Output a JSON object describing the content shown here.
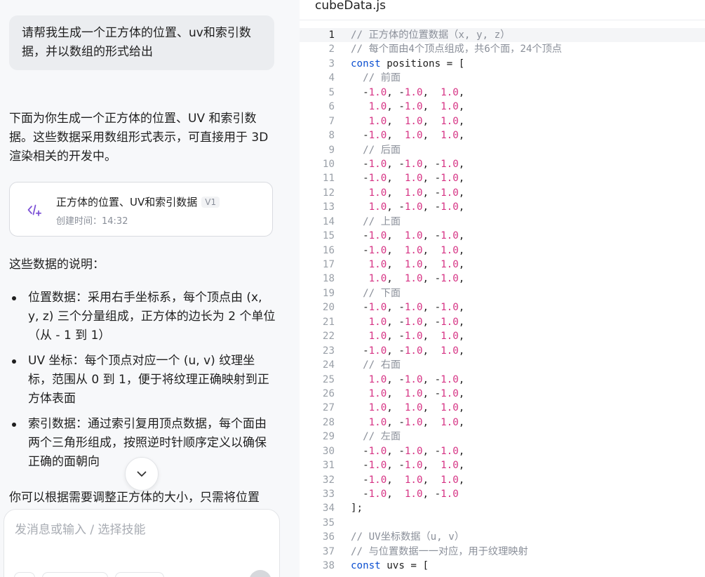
{
  "chat": {
    "user_message": "请帮我生成一个正方体的位置、uv和索引数据，并以数组的形式给出",
    "assistant_intro": "下面为你生成一个正方体的位置、UV 和索引数据。这些数据采用数组形式表示，可直接用于 3D 渲染相关的开发中。",
    "artifact": {
      "title": "正方体的位置、UV和索引数据",
      "version": "V1",
      "created": "创建时间：14:32"
    },
    "explain_heading": "这些数据的说明：",
    "bullets": [
      "位置数据：采用右手坐标系，每个顶点由 (x, y, z) 三个分量组成，正方体的边长为 2 个单位（从 - 1 到 1）",
      "UV 坐标：每个顶点对应一个 (u, v) 纹理坐标，范围从 0 到 1，便于将纹理正确映射到正方体表面",
      "索引数据：通过索引复用顶点数据，每个面由两个三角形组成，按照逆时针顺序定义以确保正确的面朝向"
    ],
    "tail_text": "你可以根据需要调整正方体的大小，只需将位置",
    "composer_placeholder": "发消息或输入 / 选择技能"
  },
  "editor": {
    "file_name": "cubeData.js",
    "active_line": 1,
    "lines": [
      [
        [
          "c",
          "// 正方体的位置数据（x, y, z）"
        ]
      ],
      [
        [
          "c",
          "// 每个面由4个顶点组成，共6个面，24个顶点"
        ]
      ],
      [
        [
          "k",
          "const"
        ],
        [
          "p",
          " positions = ["
        ]
      ],
      [
        [
          "c",
          "  // 前面"
        ]
      ],
      [
        [
          "p",
          "  -"
        ],
        [
          "n",
          "1.0"
        ],
        [
          "p",
          ", -"
        ],
        [
          "n",
          "1.0"
        ],
        [
          "p",
          ",  "
        ],
        [
          "n",
          "1.0"
        ],
        [
          "p",
          ","
        ]
      ],
      [
        [
          "p",
          "   "
        ],
        [
          "n",
          "1.0"
        ],
        [
          "p",
          ", -"
        ],
        [
          "n",
          "1.0"
        ],
        [
          "p",
          ",  "
        ],
        [
          "n",
          "1.0"
        ],
        [
          "p",
          ","
        ]
      ],
      [
        [
          "p",
          "   "
        ],
        [
          "n",
          "1.0"
        ],
        [
          "p",
          ",  "
        ],
        [
          "n",
          "1.0"
        ],
        [
          "p",
          ",  "
        ],
        [
          "n",
          "1.0"
        ],
        [
          "p",
          ","
        ]
      ],
      [
        [
          "p",
          "  -"
        ],
        [
          "n",
          "1.0"
        ],
        [
          "p",
          ",  "
        ],
        [
          "n",
          "1.0"
        ],
        [
          "p",
          ",  "
        ],
        [
          "n",
          "1.0"
        ],
        [
          "p",
          ","
        ]
      ],
      [
        [
          "c",
          "  // 后面"
        ]
      ],
      [
        [
          "p",
          "  -"
        ],
        [
          "n",
          "1.0"
        ],
        [
          "p",
          ", -"
        ],
        [
          "n",
          "1.0"
        ],
        [
          "p",
          ", -"
        ],
        [
          "n",
          "1.0"
        ],
        [
          "p",
          ","
        ]
      ],
      [
        [
          "p",
          "  -"
        ],
        [
          "n",
          "1.0"
        ],
        [
          "p",
          ",  "
        ],
        [
          "n",
          "1.0"
        ],
        [
          "p",
          ", -"
        ],
        [
          "n",
          "1.0"
        ],
        [
          "p",
          ","
        ]
      ],
      [
        [
          "p",
          "   "
        ],
        [
          "n",
          "1.0"
        ],
        [
          "p",
          ",  "
        ],
        [
          "n",
          "1.0"
        ],
        [
          "p",
          ", -"
        ],
        [
          "n",
          "1.0"
        ],
        [
          "p",
          ","
        ]
      ],
      [
        [
          "p",
          "   "
        ],
        [
          "n",
          "1.0"
        ],
        [
          "p",
          ", -"
        ],
        [
          "n",
          "1.0"
        ],
        [
          "p",
          ", -"
        ],
        [
          "n",
          "1.0"
        ],
        [
          "p",
          ","
        ]
      ],
      [
        [
          "c",
          "  // 上面"
        ]
      ],
      [
        [
          "p",
          "  -"
        ],
        [
          "n",
          "1.0"
        ],
        [
          "p",
          ",  "
        ],
        [
          "n",
          "1.0"
        ],
        [
          "p",
          ", -"
        ],
        [
          "n",
          "1.0"
        ],
        [
          "p",
          ","
        ]
      ],
      [
        [
          "p",
          "  -"
        ],
        [
          "n",
          "1.0"
        ],
        [
          "p",
          ",  "
        ],
        [
          "n",
          "1.0"
        ],
        [
          "p",
          ",  "
        ],
        [
          "n",
          "1.0"
        ],
        [
          "p",
          ","
        ]
      ],
      [
        [
          "p",
          "   "
        ],
        [
          "n",
          "1.0"
        ],
        [
          "p",
          ",  "
        ],
        [
          "n",
          "1.0"
        ],
        [
          "p",
          ",  "
        ],
        [
          "n",
          "1.0"
        ],
        [
          "p",
          ","
        ]
      ],
      [
        [
          "p",
          "   "
        ],
        [
          "n",
          "1.0"
        ],
        [
          "p",
          ",  "
        ],
        [
          "n",
          "1.0"
        ],
        [
          "p",
          ", -"
        ],
        [
          "n",
          "1.0"
        ],
        [
          "p",
          ","
        ]
      ],
      [
        [
          "c",
          "  // 下面"
        ]
      ],
      [
        [
          "p",
          "  -"
        ],
        [
          "n",
          "1.0"
        ],
        [
          "p",
          ", -"
        ],
        [
          "n",
          "1.0"
        ],
        [
          "p",
          ", -"
        ],
        [
          "n",
          "1.0"
        ],
        [
          "p",
          ","
        ]
      ],
      [
        [
          "p",
          "   "
        ],
        [
          "n",
          "1.0"
        ],
        [
          "p",
          ", -"
        ],
        [
          "n",
          "1.0"
        ],
        [
          "p",
          ", -"
        ],
        [
          "n",
          "1.0"
        ],
        [
          "p",
          ","
        ]
      ],
      [
        [
          "p",
          "   "
        ],
        [
          "n",
          "1.0"
        ],
        [
          "p",
          ", -"
        ],
        [
          "n",
          "1.0"
        ],
        [
          "p",
          ",  "
        ],
        [
          "n",
          "1.0"
        ],
        [
          "p",
          ","
        ]
      ],
      [
        [
          "p",
          "  -"
        ],
        [
          "n",
          "1.0"
        ],
        [
          "p",
          ", -"
        ],
        [
          "n",
          "1.0"
        ],
        [
          "p",
          ",  "
        ],
        [
          "n",
          "1.0"
        ],
        [
          "p",
          ","
        ]
      ],
      [
        [
          "c",
          "  // 右面"
        ]
      ],
      [
        [
          "p",
          "   "
        ],
        [
          "n",
          "1.0"
        ],
        [
          "p",
          ", -"
        ],
        [
          "n",
          "1.0"
        ],
        [
          "p",
          ", -"
        ],
        [
          "n",
          "1.0"
        ],
        [
          "p",
          ","
        ]
      ],
      [
        [
          "p",
          "   "
        ],
        [
          "n",
          "1.0"
        ],
        [
          "p",
          ",  "
        ],
        [
          "n",
          "1.0"
        ],
        [
          "p",
          ", -"
        ],
        [
          "n",
          "1.0"
        ],
        [
          "p",
          ","
        ]
      ],
      [
        [
          "p",
          "   "
        ],
        [
          "n",
          "1.0"
        ],
        [
          "p",
          ",  "
        ],
        [
          "n",
          "1.0"
        ],
        [
          "p",
          ",  "
        ],
        [
          "n",
          "1.0"
        ],
        [
          "p",
          ","
        ]
      ],
      [
        [
          "p",
          "   "
        ],
        [
          "n",
          "1.0"
        ],
        [
          "p",
          ", -"
        ],
        [
          "n",
          "1.0"
        ],
        [
          "p",
          ",  "
        ],
        [
          "n",
          "1.0"
        ],
        [
          "p",
          ","
        ]
      ],
      [
        [
          "c",
          "  // 左面"
        ]
      ],
      [
        [
          "p",
          "  -"
        ],
        [
          "n",
          "1.0"
        ],
        [
          "p",
          ", -"
        ],
        [
          "n",
          "1.0"
        ],
        [
          "p",
          ", -"
        ],
        [
          "n",
          "1.0"
        ],
        [
          "p",
          ","
        ]
      ],
      [
        [
          "p",
          "  -"
        ],
        [
          "n",
          "1.0"
        ],
        [
          "p",
          ", -"
        ],
        [
          "n",
          "1.0"
        ],
        [
          "p",
          ",  "
        ],
        [
          "n",
          "1.0"
        ],
        [
          "p",
          ","
        ]
      ],
      [
        [
          "p",
          "  -"
        ],
        [
          "n",
          "1.0"
        ],
        [
          "p",
          ",  "
        ],
        [
          "n",
          "1.0"
        ],
        [
          "p",
          ",  "
        ],
        [
          "n",
          "1.0"
        ],
        [
          "p",
          ","
        ]
      ],
      [
        [
          "p",
          "  -"
        ],
        [
          "n",
          "1.0"
        ],
        [
          "p",
          ",  "
        ],
        [
          "n",
          "1.0"
        ],
        [
          "p",
          ", -"
        ],
        [
          "n",
          "1.0"
        ]
      ],
      [
        [
          "p",
          "];"
        ]
      ],
      [
        [
          "p",
          ""
        ]
      ],
      [
        [
          "c",
          "// UV坐标数据（u, v）"
        ]
      ],
      [
        [
          "c",
          "// 与位置数据一一对应，用于纹理映射"
        ]
      ],
      [
        [
          "k",
          "const"
        ],
        [
          "p",
          " uvs = ["
        ]
      ]
    ]
  },
  "colors": {
    "comment": "#8a8f99",
    "number": "#d63384",
    "keyword": "#0b4fd1",
    "chat_bg": "#f7f8fa",
    "icon_accent": "#7b4fd6"
  }
}
